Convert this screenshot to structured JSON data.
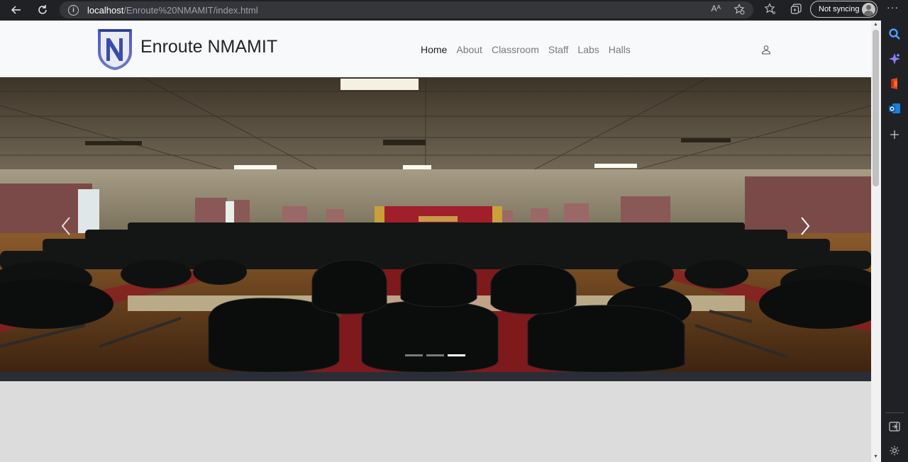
{
  "browser": {
    "url_host": "localhost",
    "url_path": "/Enroute%20NMAMIT/index.html",
    "sync_label": "Not syncing",
    "read_aloud_label": "Aᴬ"
  },
  "site": {
    "brand": "Enroute NMAMIT",
    "logo_letter": "N",
    "nav": [
      "Home",
      "About",
      "Classroom",
      "Staff",
      "Labs",
      "Halls"
    ],
    "active_nav": "Home"
  },
  "carousel": {
    "slide_count": 3,
    "active_slide": 3,
    "prev_glyph": "‹",
    "next_glyph": "›"
  },
  "colors": {
    "chrome_bg": "#202124",
    "header_bg": "#f8f9fa",
    "band": "#2b2d36",
    "page_bg": "#dcdcdc",
    "brand_blue": "#3b4ca8"
  },
  "icons": [
    "back-icon",
    "reload-icon",
    "info-icon",
    "read-aloud-icon",
    "favorite-add-icon",
    "favorites-icon",
    "collections-icon",
    "profile-icon",
    "more-icon",
    "user-icon",
    "search-icon",
    "copilot-icon",
    "office-icon",
    "outlook-icon",
    "add-icon",
    "sidebar-toggle-icon",
    "settings-icon"
  ]
}
